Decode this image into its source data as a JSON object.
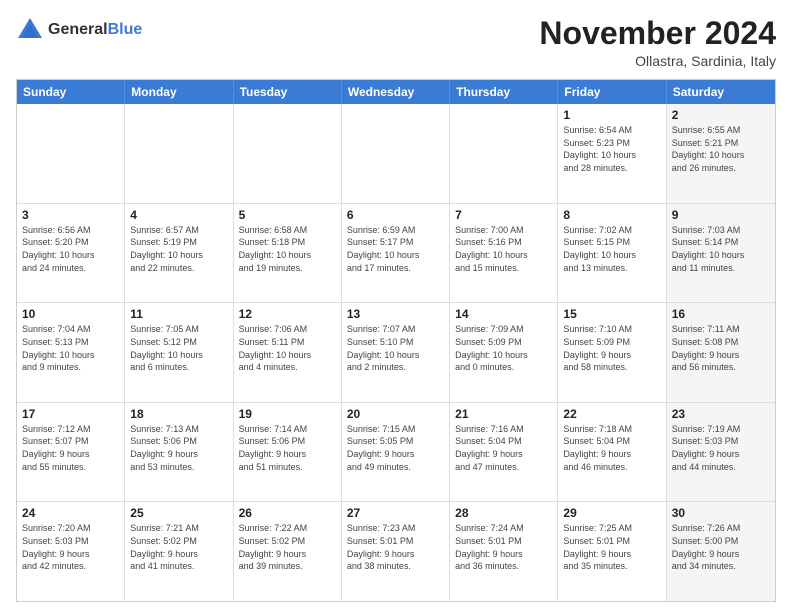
{
  "logo": {
    "general": "General",
    "blue": "Blue"
  },
  "title": "November 2024",
  "location": "Ollastra, Sardinia, Italy",
  "headers": [
    "Sunday",
    "Monday",
    "Tuesday",
    "Wednesday",
    "Thursday",
    "Friday",
    "Saturday"
  ],
  "weeks": [
    [
      {
        "day": "",
        "info": "",
        "shaded": false
      },
      {
        "day": "",
        "info": "",
        "shaded": false
      },
      {
        "day": "",
        "info": "",
        "shaded": false
      },
      {
        "day": "",
        "info": "",
        "shaded": false
      },
      {
        "day": "",
        "info": "",
        "shaded": false
      },
      {
        "day": "1",
        "info": "Sunrise: 6:54 AM\nSunset: 5:23 PM\nDaylight: 10 hours\nand 28 minutes.",
        "shaded": false
      },
      {
        "day": "2",
        "info": "Sunrise: 6:55 AM\nSunset: 5:21 PM\nDaylight: 10 hours\nand 26 minutes.",
        "shaded": true
      }
    ],
    [
      {
        "day": "3",
        "info": "Sunrise: 6:56 AM\nSunset: 5:20 PM\nDaylight: 10 hours\nand 24 minutes.",
        "shaded": false
      },
      {
        "day": "4",
        "info": "Sunrise: 6:57 AM\nSunset: 5:19 PM\nDaylight: 10 hours\nand 22 minutes.",
        "shaded": false
      },
      {
        "day": "5",
        "info": "Sunrise: 6:58 AM\nSunset: 5:18 PM\nDaylight: 10 hours\nand 19 minutes.",
        "shaded": false
      },
      {
        "day": "6",
        "info": "Sunrise: 6:59 AM\nSunset: 5:17 PM\nDaylight: 10 hours\nand 17 minutes.",
        "shaded": false
      },
      {
        "day": "7",
        "info": "Sunrise: 7:00 AM\nSunset: 5:16 PM\nDaylight: 10 hours\nand 15 minutes.",
        "shaded": false
      },
      {
        "day": "8",
        "info": "Sunrise: 7:02 AM\nSunset: 5:15 PM\nDaylight: 10 hours\nand 13 minutes.",
        "shaded": false
      },
      {
        "day": "9",
        "info": "Sunrise: 7:03 AM\nSunset: 5:14 PM\nDaylight: 10 hours\nand 11 minutes.",
        "shaded": true
      }
    ],
    [
      {
        "day": "10",
        "info": "Sunrise: 7:04 AM\nSunset: 5:13 PM\nDaylight: 10 hours\nand 9 minutes.",
        "shaded": false
      },
      {
        "day": "11",
        "info": "Sunrise: 7:05 AM\nSunset: 5:12 PM\nDaylight: 10 hours\nand 6 minutes.",
        "shaded": false
      },
      {
        "day": "12",
        "info": "Sunrise: 7:06 AM\nSunset: 5:11 PM\nDaylight: 10 hours\nand 4 minutes.",
        "shaded": false
      },
      {
        "day": "13",
        "info": "Sunrise: 7:07 AM\nSunset: 5:10 PM\nDaylight: 10 hours\nand 2 minutes.",
        "shaded": false
      },
      {
        "day": "14",
        "info": "Sunrise: 7:09 AM\nSunset: 5:09 PM\nDaylight: 10 hours\nand 0 minutes.",
        "shaded": false
      },
      {
        "day": "15",
        "info": "Sunrise: 7:10 AM\nSunset: 5:09 PM\nDaylight: 9 hours\nand 58 minutes.",
        "shaded": false
      },
      {
        "day": "16",
        "info": "Sunrise: 7:11 AM\nSunset: 5:08 PM\nDaylight: 9 hours\nand 56 minutes.",
        "shaded": true
      }
    ],
    [
      {
        "day": "17",
        "info": "Sunrise: 7:12 AM\nSunset: 5:07 PM\nDaylight: 9 hours\nand 55 minutes.",
        "shaded": false
      },
      {
        "day": "18",
        "info": "Sunrise: 7:13 AM\nSunset: 5:06 PM\nDaylight: 9 hours\nand 53 minutes.",
        "shaded": false
      },
      {
        "day": "19",
        "info": "Sunrise: 7:14 AM\nSunset: 5:06 PM\nDaylight: 9 hours\nand 51 minutes.",
        "shaded": false
      },
      {
        "day": "20",
        "info": "Sunrise: 7:15 AM\nSunset: 5:05 PM\nDaylight: 9 hours\nand 49 minutes.",
        "shaded": false
      },
      {
        "day": "21",
        "info": "Sunrise: 7:16 AM\nSunset: 5:04 PM\nDaylight: 9 hours\nand 47 minutes.",
        "shaded": false
      },
      {
        "day": "22",
        "info": "Sunrise: 7:18 AM\nSunset: 5:04 PM\nDaylight: 9 hours\nand 46 minutes.",
        "shaded": false
      },
      {
        "day": "23",
        "info": "Sunrise: 7:19 AM\nSunset: 5:03 PM\nDaylight: 9 hours\nand 44 minutes.",
        "shaded": true
      }
    ],
    [
      {
        "day": "24",
        "info": "Sunrise: 7:20 AM\nSunset: 5:03 PM\nDaylight: 9 hours\nand 42 minutes.",
        "shaded": false
      },
      {
        "day": "25",
        "info": "Sunrise: 7:21 AM\nSunset: 5:02 PM\nDaylight: 9 hours\nand 41 minutes.",
        "shaded": false
      },
      {
        "day": "26",
        "info": "Sunrise: 7:22 AM\nSunset: 5:02 PM\nDaylight: 9 hours\nand 39 minutes.",
        "shaded": false
      },
      {
        "day": "27",
        "info": "Sunrise: 7:23 AM\nSunset: 5:01 PM\nDaylight: 9 hours\nand 38 minutes.",
        "shaded": false
      },
      {
        "day": "28",
        "info": "Sunrise: 7:24 AM\nSunset: 5:01 PM\nDaylight: 9 hours\nand 36 minutes.",
        "shaded": false
      },
      {
        "day": "29",
        "info": "Sunrise: 7:25 AM\nSunset: 5:01 PM\nDaylight: 9 hours\nand 35 minutes.",
        "shaded": false
      },
      {
        "day": "30",
        "info": "Sunrise: 7:26 AM\nSunset: 5:00 PM\nDaylight: 9 hours\nand 34 minutes.",
        "shaded": true
      }
    ]
  ]
}
